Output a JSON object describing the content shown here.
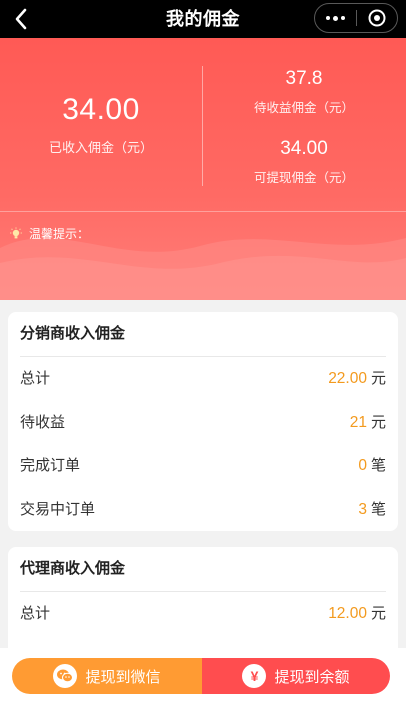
{
  "header": {
    "title": "我的佣金"
  },
  "summary": {
    "received_amount": "34.00",
    "received_label": "已收入佣金（元）",
    "pending_amount": "37.8",
    "pending_label": "待收益佣金（元）",
    "withdrawable_amount": "34.00",
    "withdrawable_label": "可提现佣金（元）"
  },
  "tip": {
    "label": "温馨提示："
  },
  "distributor": {
    "title": "分销商收入佣金",
    "rows": [
      {
        "label": "总计",
        "value": "22.00",
        "unit": "元"
      },
      {
        "label": "待收益",
        "value": "21",
        "unit": "元"
      },
      {
        "label": "完成订单",
        "value": "0",
        "unit": "笔"
      },
      {
        "label": "交易中订单",
        "value": "3",
        "unit": "笔"
      }
    ]
  },
  "agent": {
    "title": "代理商收入佣金",
    "rows": [
      {
        "label": "总计",
        "value": "12.00",
        "unit": "元"
      }
    ]
  },
  "actions": {
    "wechat_label": "提现到微信",
    "balance_label": "提现到余额",
    "balance_icon_glyph": "¥"
  },
  "colors": {
    "hero_red": "#ff5a55",
    "amount_orange": "#f39a1e",
    "wechat_orange": "#ff9b33",
    "balance_red": "#ff4d4f"
  }
}
